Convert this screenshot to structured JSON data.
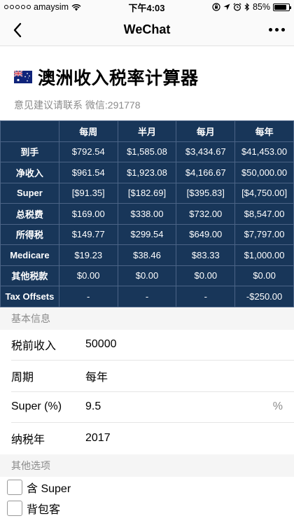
{
  "status": {
    "carrier": "amaysim",
    "time": "下午4:03",
    "battery_pct": "85%",
    "battery_level": 0.85
  },
  "nav": {
    "title": "WeChat"
  },
  "header": {
    "title": "澳洲收入税率计算器",
    "subtitle": "意见建议请联系 微信:291778"
  },
  "table": {
    "columns": [
      "每周",
      "半月",
      "每月",
      "每年"
    ],
    "rows": [
      {
        "label": "到手",
        "values": [
          "$792.54",
          "$1,585.08",
          "$3,434.67",
          "$41,453.00"
        ]
      },
      {
        "label": "净收入",
        "values": [
          "$961.54",
          "$1,923.08",
          "$4,166.67",
          "$50,000.00"
        ]
      },
      {
        "label": "Super",
        "values": [
          "[$91.35]",
          "[$182.69]",
          "[$395.83]",
          "[$4,750.00]"
        ]
      },
      {
        "label": "总税费",
        "values": [
          "$169.00",
          "$338.00",
          "$732.00",
          "$8,547.00"
        ]
      },
      {
        "label": "所得税",
        "values": [
          "$149.77",
          "$299.54",
          "$649.00",
          "$7,797.00"
        ]
      },
      {
        "label": "Medicare",
        "values": [
          "$19.23",
          "$38.46",
          "$83.33",
          "$1,000.00"
        ]
      },
      {
        "label": "其他税款",
        "values": [
          "$0.00",
          "$0.00",
          "$0.00",
          "$0.00"
        ]
      },
      {
        "label": "Tax Offsets",
        "values": [
          "-",
          "-",
          "-",
          "-$250.00"
        ]
      }
    ]
  },
  "basic": {
    "section_label": "基本信息",
    "fields": [
      {
        "label": "税前收入",
        "value": "50000"
      },
      {
        "label": "周期",
        "value": "每年"
      },
      {
        "label": "Super (%)",
        "value": "9.5",
        "suffix": "%"
      },
      {
        "label": "纳税年",
        "value": "2017"
      }
    ]
  },
  "other": {
    "section_label": "其他选项",
    "options": [
      {
        "label": "含 Super"
      },
      {
        "label": "背包客"
      }
    ]
  }
}
